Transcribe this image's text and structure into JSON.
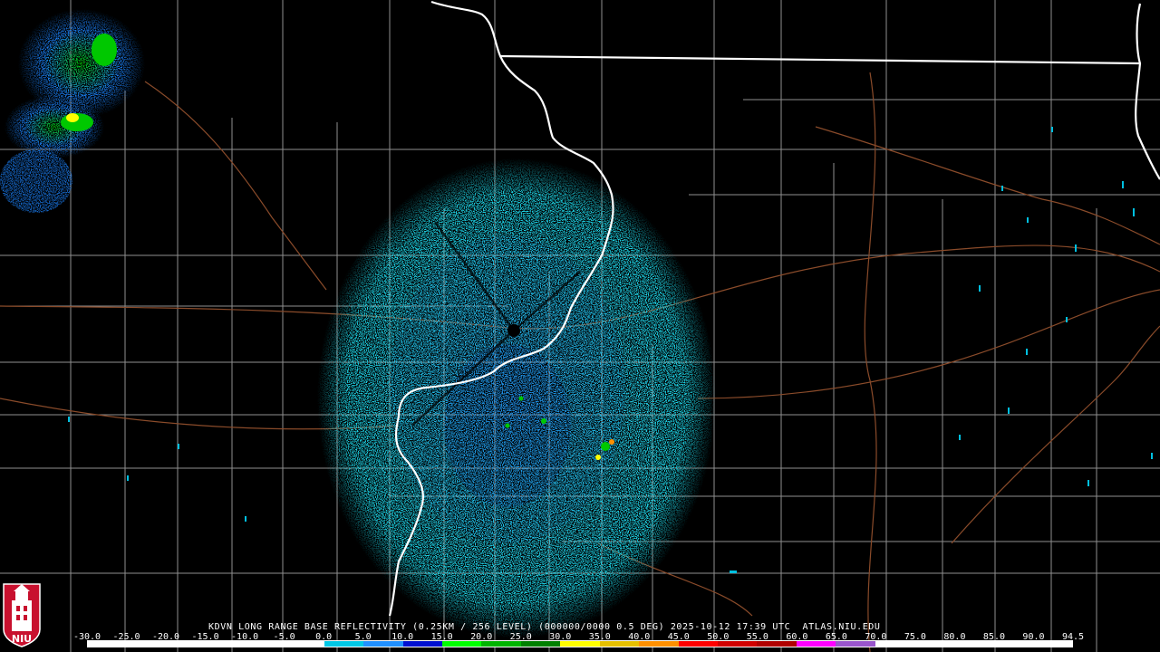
{
  "caption": {
    "station": "KDVN",
    "product": "LONG RANGE BASE REFLECTIVITY",
    "detail": "(0.25KM / 256 LEVEL)",
    "code": "(000000/0000 0.5 DEG)",
    "datetime": "2025-10-12 17:39 UTC",
    "source": "ATLAS.NIU.EDU"
  },
  "logo": {
    "text": "NIU",
    "colors": {
      "shield": "#c8102e",
      "tower": "#ffffff"
    }
  },
  "scale": {
    "ticks": [
      "-30.0",
      "-25.0",
      "-20.0",
      "-15.0",
      "-10.0",
      "-5.0",
      "0.0",
      "5.0",
      "10.0",
      "15.0",
      "20.0",
      "25.0",
      "30.0",
      "35.0",
      "40.0",
      "45.0",
      "50.0",
      "55.0",
      "60.0",
      "65.0",
      "70.0",
      "75.0",
      "80.0",
      "85.0",
      "90.0",
      "94.5"
    ],
    "colors": [
      "#ffffff",
      "#ffffff",
      "#ffffff",
      "#ffffff",
      "#ffffff",
      "#ffffff",
      "#00c8e6",
      "#2090ff",
      "#0010d0",
      "#00ff00",
      "#00b400",
      "#008000",
      "#ffff00",
      "#e6c000",
      "#ff9000",
      "#ff0000",
      "#d00000",
      "#b00000",
      "#ff00ff",
      "#9955cc",
      "#ffffff",
      "#ffffff",
      "#ffffff",
      "#ffffff",
      "#ffffff"
    ]
  },
  "map_colors": {
    "background": "#000000",
    "state_line": "#ffffff",
    "county_line": "#9a9a9a",
    "highway": "#a0522d"
  }
}
